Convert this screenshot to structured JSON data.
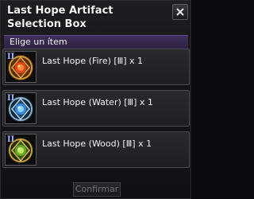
{
  "window": {
    "title": "Last Hope Artifact Selection Box",
    "close_icon": "close-icon"
  },
  "prompt": "Elige un ítem",
  "items": [
    {
      "label": "Last Hope (Fire) [Ⅲ] x 1",
      "tier": "II",
      "icon": "fire-artifact-icon"
    },
    {
      "label": "Last Hope (Water) [Ⅲ] x 1",
      "tier": "II",
      "icon": "water-artifact-icon"
    },
    {
      "label": "Last Hope (Wood) [Ⅲ] x 1",
      "tier": "II",
      "icon": "wood-artifact-icon"
    }
  ],
  "confirm_label": "Confirmar",
  "colors": {
    "subheader": "#3f2f5c",
    "fire": "#e04a1a",
    "water": "#5aa8ff",
    "wood": "#7ac23a",
    "gold_frame": "#c99a3a"
  }
}
